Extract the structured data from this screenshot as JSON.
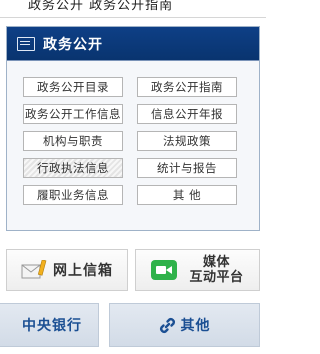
{
  "top_strip": {
    "cut_text": "政务公开 政务公开指南"
  },
  "panel": {
    "title": "政务公开",
    "items": [
      {
        "label": "政务公开目录"
      },
      {
        "label": "政务公开指南"
      },
      {
        "label": "政务公开工作信息"
      },
      {
        "label": "信息公开年报"
      },
      {
        "label": "机构与职责"
      },
      {
        "label": "法规政策"
      },
      {
        "label": "行政执法信息"
      },
      {
        "label": "统计与报告"
      },
      {
        "label": "履职业务信息"
      },
      {
        "label": "其 他"
      }
    ]
  },
  "mailbox": {
    "label": "网上信箱",
    "icon": "envelope-pencil-icon"
  },
  "media": {
    "label_line1": "媒体",
    "label_line2": "互动平台",
    "icon": "video-camera-icon",
    "icon_color": "#2fb24a"
  },
  "bank_link": {
    "label": "中央银行"
  },
  "other_link": {
    "label": "其他",
    "icon": "link-icon"
  },
  "colors": {
    "header_bg": "#0e3f86",
    "link_text": "#1b4f93",
    "panel_bg": "#f5f7fa"
  }
}
